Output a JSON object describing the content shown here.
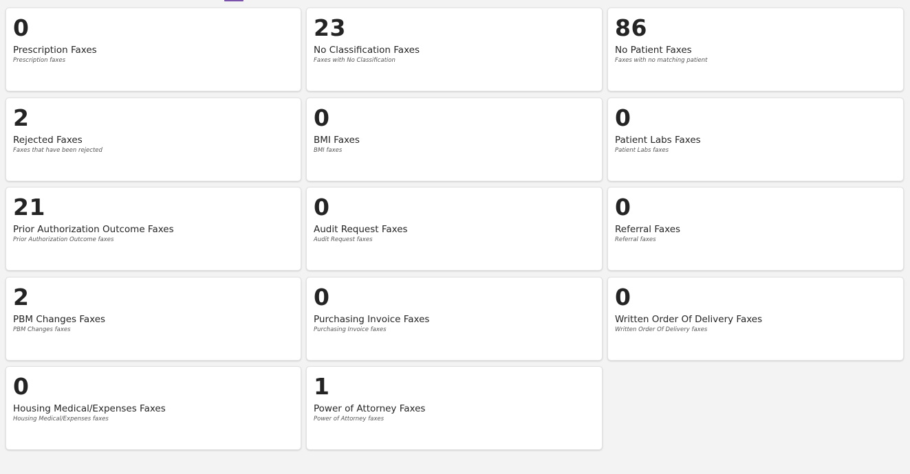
{
  "cards": [
    {
      "count": "0",
      "title": "Prescription Faxes",
      "description": "Prescription faxes"
    },
    {
      "count": "23",
      "title": "No Classification Faxes",
      "description": "Faxes with No Classification"
    },
    {
      "count": "86",
      "title": "No Patient Faxes",
      "description": "Faxes with no matching patient"
    },
    {
      "count": "2",
      "title": "Rejected Faxes",
      "description": "Faxes that have been rejected"
    },
    {
      "count": "0",
      "title": "BMI Faxes",
      "description": "BMI faxes"
    },
    {
      "count": "0",
      "title": "Patient Labs Faxes",
      "description": "Patient Labs faxes"
    },
    {
      "count": "21",
      "title": "Prior Authorization Outcome Faxes",
      "description": "Prior Authorization Outcome faxes"
    },
    {
      "count": "0",
      "title": "Audit Request Faxes",
      "description": "Audit Request faxes"
    },
    {
      "count": "0",
      "title": "Referral Faxes",
      "description": "Referral faxes"
    },
    {
      "count": "2",
      "title": "PBM Changes Faxes",
      "description": "PBM Changes faxes"
    },
    {
      "count": "0",
      "title": "Purchasing Invoice Faxes",
      "description": "Purchasing Invoice faxes"
    },
    {
      "count": "0",
      "title": "Written Order Of Delivery Faxes",
      "description": "Written Order Of Delivery faxes"
    },
    {
      "count": "0",
      "title": "Housing Medical/Expenses Faxes",
      "description": "Housing Medical/Expenses faxes"
    },
    {
      "count": "1",
      "title": "Power of Attorney Faxes",
      "description": "Power of Attorney faxes"
    }
  ],
  "colors": {
    "background": "#f3f3f3",
    "card": "#ffffff",
    "text": "#242424",
    "accent": "#7b52ab"
  }
}
